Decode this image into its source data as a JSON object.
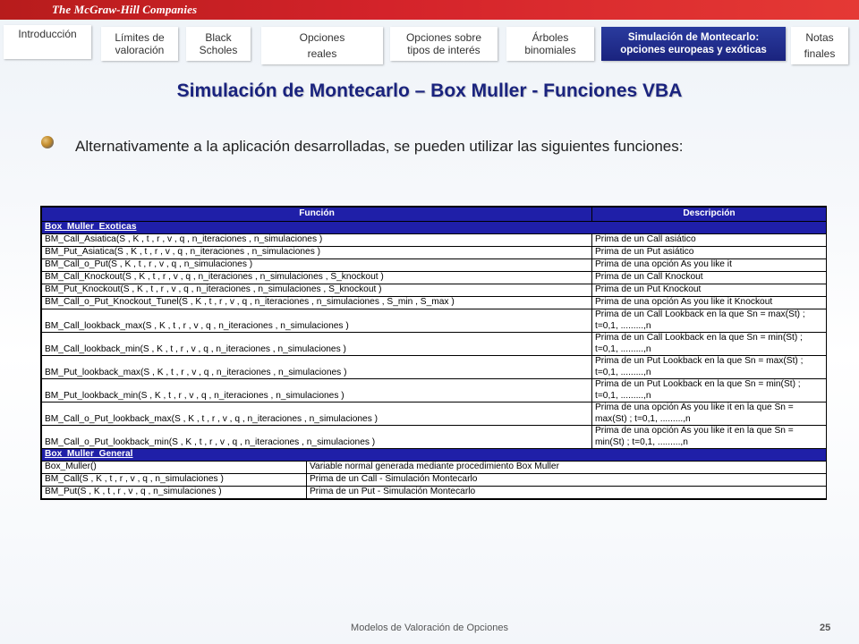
{
  "header": {
    "logo_text": "The McGraw-Hill Companies"
  },
  "nav": {
    "tabs": [
      {
        "label": "Introducción"
      },
      {
        "label": "Límites de\nvaloración"
      },
      {
        "label": "Black\nScholes"
      },
      {
        "label": "Opciones\nreales"
      },
      {
        "label": "Opciones sobre\ntipos de interés"
      },
      {
        "label": "Árboles\nbinomiales"
      },
      {
        "label": "Simulación de Montecarlo:\nopciones europeas y exóticas"
      },
      {
        "label": "Notas\nfinales"
      }
    ]
  },
  "title": "Simulación de Montecarlo – Box Muller - Funciones VBA",
  "body_text": "Alternativamente a la aplicación desarrolladas, se pueden utilizar las siguientes funciones:",
  "table": {
    "headers": {
      "funcion": "Función",
      "descripcion": "Descripción"
    },
    "sections": [
      {
        "name": "Box_Muller_Exoticas"
      },
      {
        "name": "Box_Muller_General"
      }
    ],
    "exoticas": [
      {
        "f": "BM_Call_Asiatica(S , K , t , r , v , q , n_iteraciones , n_simulaciones )",
        "d": "Prima de un Call asiático"
      },
      {
        "f": "BM_Put_Asiatica(S , K , t , r , v , q , n_iteraciones , n_simulaciones )",
        "d": "Prima de un Put  asiático"
      },
      {
        "f": "BM_Call_o_Put(S , K , t , r , v , q , n_simulaciones )",
        "d": "Prima de una opción As you like it"
      },
      {
        "f": "BM_Call_Knockout(S , K , t , r , v , q , n_iteraciones , n_simulaciones , S_knockout )",
        "d": "Prima de un Call Knockout"
      },
      {
        "f": "BM_Put_Knockout(S , K , t , r , v , q , n_iteraciones , n_simulaciones , S_knockout )",
        "d": "Prima de un Put Knockout"
      },
      {
        "f": "BM_Call_o_Put_Knockout_Tunel(S , K , t , r , v , q , n_iteraciones , n_simulaciones , S_min , S_max )",
        "d": "Prima de una opción As you like it Knockout"
      },
      {
        "f": "BM_Call_lookback_max(S , K , t , r , v , q , n_iteraciones , n_simulaciones )",
        "d": "Prima de un Call Lookback en la que Sn = max(St) ; t=0,1, .........,n"
      },
      {
        "f": "BM_Call_lookback_min(S , K , t , r , v , q , n_iteraciones , n_simulaciones )",
        "d": "Prima de un Call Lookback en la que Sn = min(St) ; t=0,1, .........,n"
      },
      {
        "f": "BM_Put_lookback_max(S , K , t , r , v , q , n_iteraciones , n_simulaciones )",
        "d": "Prima de un Put Lookback en la que Sn = max(St) ; t=0,1, .........,n"
      },
      {
        "f": "BM_Put_lookback_min(S , K , t , r , v , q , n_iteraciones , n_simulaciones )",
        "d": "Prima de un Put Lookback en la que Sn = min(St) ; t=0,1, .........,n"
      },
      {
        "f": "BM_Call_o_Put_lookback_max(S , K , t , r , v , q , n_iteraciones , n_simulaciones )",
        "d": "Prima de una opción As you like it en la que Sn = max(St) ; t=0,1, .........,n"
      },
      {
        "f": "BM_Call_o_Put_lookback_min(S , K , t , r , v , q , n_iteraciones , n_simulaciones )",
        "d": "Prima de una opción As you like it en la que Sn = min(St) ; t=0,1, .........,n"
      }
    ],
    "general": [
      {
        "f": "Box_Muller()",
        "d": "Variable normal generada mediante procedimiento Box Muller"
      },
      {
        "f": "BM_Call(S , K , t , r , v , q , n_simulaciones )",
        "d": "Prima de un Call - Simulación Montecarlo"
      },
      {
        "f": "BM_Put(S , K , t , r , v , q , n_simulaciones )",
        "d": "Prima de un Put - Simulación Montecarlo"
      }
    ]
  },
  "footer": {
    "text": "Modelos de Valoración de Opciones",
    "page": "25"
  },
  "colors": {
    "brand_red": "#d4232a",
    "navy": "#1a237e",
    "table_header": "#1f1fa8"
  }
}
